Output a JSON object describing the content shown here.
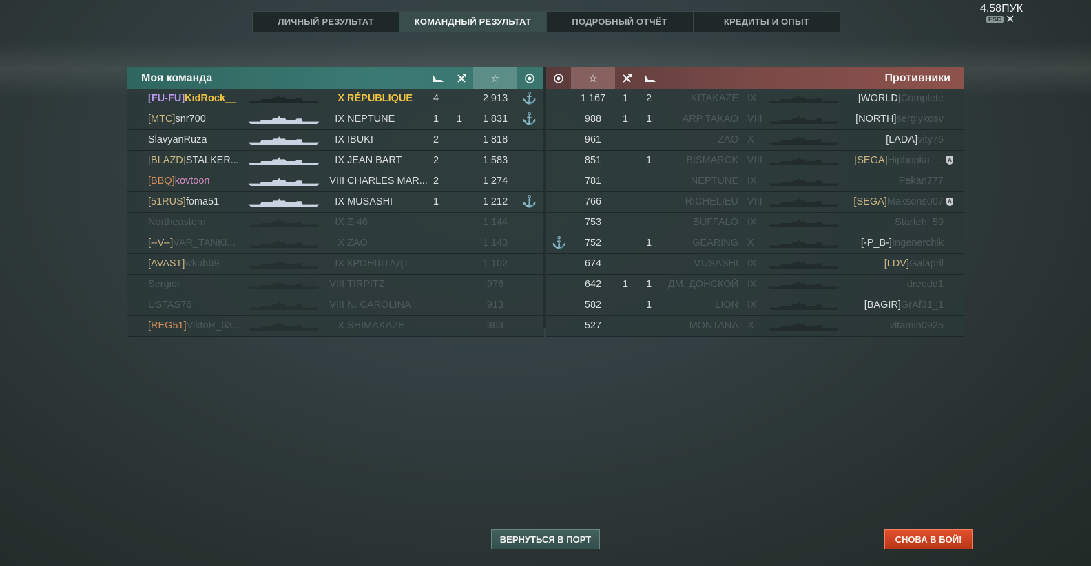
{
  "tabs": [
    "ЛИЧНЫЙ РЕЗУЛЬТАТ",
    "КОМАНДНЫЙ РЕЗУЛЬТАТ",
    "ПОДРОБНЫЙ ОТЧЁТ",
    "КРЕДИТЫ И ОПЫТ"
  ],
  "active_tab": 1,
  "top_right_value": "4.58ПУК",
  "esc_label": "ESC",
  "close_icon": "✕",
  "my_team": {
    "title": "Моя команда",
    "header_icons": [
      "plane-icon",
      "ship-kill-icon",
      "star-icon",
      "laurel-icon"
    ],
    "rows": [
      {
        "clan": "[FU-FU]",
        "nick": "KidRock__",
        "tier": "X",
        "ship": "RÉPUBLIQUE",
        "kills": "4",
        "planes": "",
        "score": "2 913",
        "anchor": true,
        "style": "gold"
      },
      {
        "clan": "[MTC]",
        "nick": "snr700",
        "tier": "IX",
        "ship": "NEPTUNE",
        "kills": "1",
        "planes": "1",
        "score": "1 831",
        "anchor": true,
        "style": "alive"
      },
      {
        "clan": "",
        "nick": "SlavyanRuza",
        "tier": "IX",
        "ship": "IBUKI",
        "kills": "2",
        "planes": "",
        "score": "1 818",
        "anchor": false,
        "style": "alive"
      },
      {
        "clan": "[BLAZD]",
        "nick": "STALKER...",
        "tier": "IX",
        "ship": "JEAN BART",
        "kills": "2",
        "planes": "",
        "score": "1 583",
        "anchor": false,
        "style": "alive"
      },
      {
        "clan": "[BBQ]",
        "nick": "kovtoon",
        "tier": "VIII",
        "ship": "CHARLES MAR...",
        "kills": "2",
        "planes": "",
        "score": "1 274",
        "anchor": false,
        "style": "pink"
      },
      {
        "clan": "[51RUS]",
        "nick": "foma51",
        "tier": "IX",
        "ship": "MUSASHI",
        "kills": "1",
        "planes": "",
        "score": "1 212",
        "anchor": true,
        "style": "alive"
      },
      {
        "clan": "",
        "nick": "Northeastern",
        "tier": "IX",
        "ship": "Z-46",
        "kills": "",
        "planes": "",
        "score": "1 144",
        "anchor": false,
        "style": "dead"
      },
      {
        "clan": "[--V--]",
        "nick": "VAR_TANKI...",
        "tier": "X",
        "ship": "ZAO",
        "kills": "",
        "planes": "",
        "score": "1 143",
        "anchor": false,
        "style": "dead"
      },
      {
        "clan": "[AVAST]",
        "nick": "wkub69",
        "tier": "IX",
        "ship": "КРОНШТАДТ",
        "kills": "",
        "planes": "",
        "score": "1 102",
        "anchor": false,
        "style": "dead"
      },
      {
        "clan": "",
        "nick": "Sergior",
        "tier": "VIII",
        "ship": "TIRPITZ",
        "kills": "",
        "planes": "",
        "score": "976",
        "anchor": false,
        "style": "dead"
      },
      {
        "clan": "",
        "nick": "USTAS76",
        "tier": "VIII",
        "ship": "N. CAROLINA",
        "kills": "",
        "planes": "",
        "score": "913",
        "anchor": false,
        "style": "dead"
      },
      {
        "clan": "[REG51]",
        "nick": "ViktoR_63...",
        "tier": "X",
        "ship": "SHIMAKAZE",
        "kills": "",
        "planes": "",
        "score": "363",
        "anchor": false,
        "style": "dead-orange"
      }
    ]
  },
  "enemy_team": {
    "title": "Противники",
    "header_icons": [
      "laurel-icon",
      "star-icon",
      "ship-kill-icon",
      "plane-icon"
    ],
    "rows": [
      {
        "clan": "[WORLD]",
        "nick": "Complete",
        "tier": "IX",
        "ship": "KITAKAZE",
        "kills": "2",
        "planes": "1",
        "score": "1 167",
        "anchor": false,
        "badge": false
      },
      {
        "clan": "[NORTH]",
        "nick": "sergiykosv",
        "tier": "VIII",
        "ship": "ARP TAKAO",
        "kills": "1",
        "planes": "1",
        "score": "988",
        "anchor": false,
        "badge": false
      },
      {
        "clan": "[LADA]",
        "nick": "vity76",
        "tier": "X",
        "ship": "ZAO",
        "kills": "",
        "planes": "",
        "score": "961",
        "anchor": false,
        "badge": false
      },
      {
        "clan": "[SEGA]",
        "nick": "Hiphopka_...",
        "tier": "VIII",
        "ship": "BISMARCK",
        "kills": "1",
        "planes": "",
        "score": "851",
        "anchor": false,
        "badge": true
      },
      {
        "clan": "",
        "nick": "Pekan777",
        "tier": "IX",
        "ship": "NEPTUNE",
        "kills": "",
        "planes": "",
        "score": "781",
        "anchor": false,
        "badge": false
      },
      {
        "clan": "[SEGA]",
        "nick": "Maksons007",
        "tier": "VIII",
        "ship": "RICHELIEU",
        "kills": "",
        "planes": "",
        "score": "766",
        "anchor": false,
        "badge": true
      },
      {
        "clan": "",
        "nick": "Starteh_59",
        "tier": "IX",
        "ship": "BUFFALO",
        "kills": "",
        "planes": "",
        "score": "753",
        "anchor": false,
        "badge": false
      },
      {
        "clan": "[-P_B-]",
        "nick": "Ingenerchik",
        "tier": "X",
        "ship": "GEARING",
        "kills": "1",
        "planes": "",
        "score": "752",
        "anchor": true,
        "badge": false
      },
      {
        "clan": "[LDV]",
        "nick": "Galapril",
        "tier": "IX",
        "ship": "MUSASHI",
        "kills": "",
        "planes": "",
        "score": "674",
        "anchor": false,
        "badge": false
      },
      {
        "clan": "",
        "nick": "dreedd1",
        "tier": "IX",
        "ship": "ДМ. ДОНСКОЙ",
        "kills": "1",
        "planes": "1",
        "score": "642",
        "anchor": false,
        "badge": false
      },
      {
        "clan": "[BAGIR]",
        "nick": "GrAf31_1",
        "tier": "IX",
        "ship": "LION",
        "kills": "1",
        "planes": "",
        "score": "582",
        "anchor": false,
        "badge": false
      },
      {
        "clan": "",
        "nick": "vitamin0925",
        "tier": "X",
        "ship": "MONTANA",
        "kills": "",
        "planes": "",
        "score": "527",
        "anchor": false,
        "badge": false
      }
    ]
  },
  "buttons": {
    "port": "ВЕРНУТЬСЯ В ПОРТ",
    "battle": "СНОВА В БОЙ!"
  },
  "colors": {
    "gold": "#f1c442",
    "clan": "#c9b483",
    "purple": "#b99af0",
    "pink": "#d58cc2",
    "orange": "#d18e5a",
    "battle_button": "#d0421f"
  }
}
